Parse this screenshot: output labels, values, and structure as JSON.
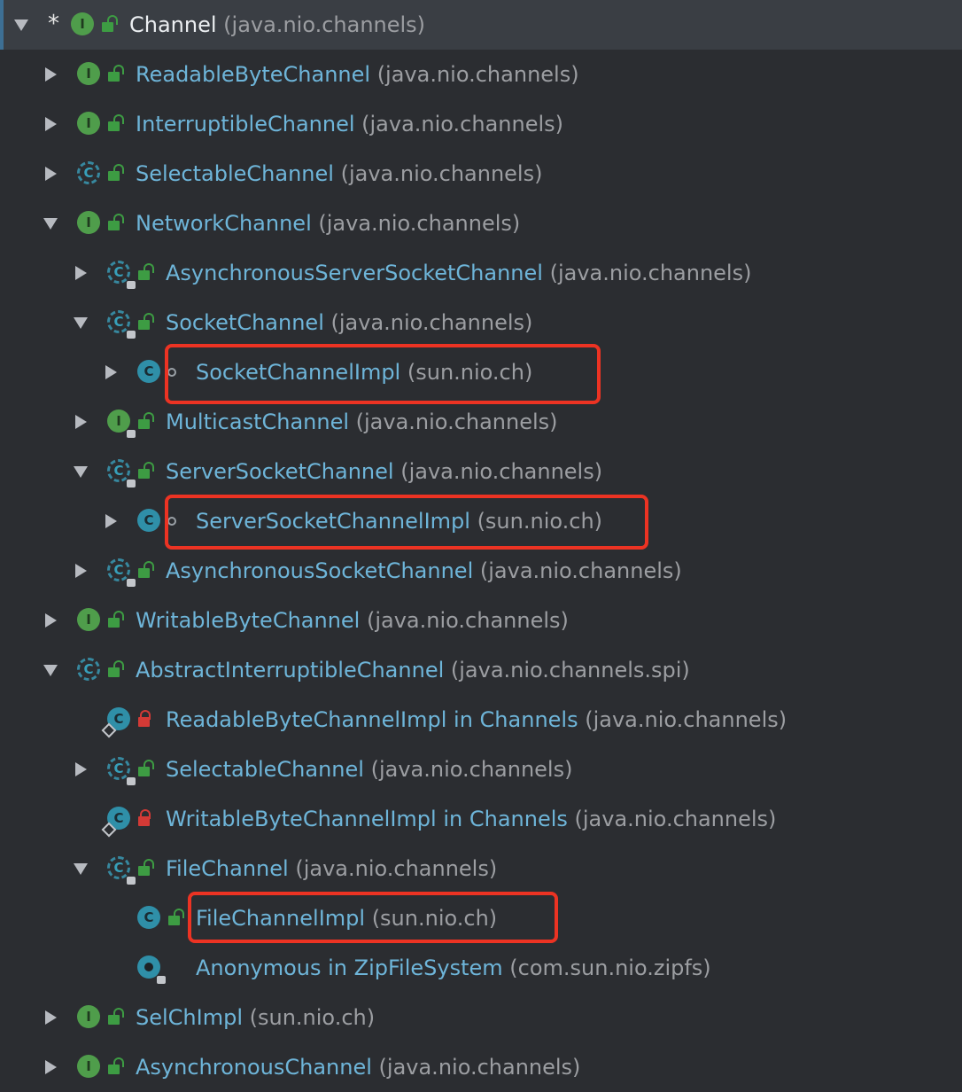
{
  "tree": {
    "rows": [
      {
        "name": "Channel",
        "package": "(java.nio.channels)",
        "root": true,
        "selected": true
      },
      {
        "name": "ReadableByteChannel",
        "package": "(java.nio.channels)"
      },
      {
        "name": "InterruptibleChannel",
        "package": "(java.nio.channels)"
      },
      {
        "name": "SelectableChannel",
        "package": "(java.nio.channels)"
      },
      {
        "name": "NetworkChannel",
        "package": "(java.nio.channels)"
      },
      {
        "name": "AsynchronousServerSocketChannel",
        "package": "(java.nio.channels)"
      },
      {
        "name": "SocketChannel",
        "package": "(java.nio.channels)"
      },
      {
        "name": "SocketChannelImpl",
        "package": "(sun.nio.ch)"
      },
      {
        "name": "MulticastChannel",
        "package": "(java.nio.channels)"
      },
      {
        "name": "ServerSocketChannel",
        "package": "(java.nio.channels)"
      },
      {
        "name": "ServerSocketChannelImpl",
        "package": "(sun.nio.ch)"
      },
      {
        "name": "AsynchronousSocketChannel",
        "package": "(java.nio.channels)"
      },
      {
        "name": "WritableByteChannel",
        "package": "(java.nio.channels)"
      },
      {
        "name": "AbstractInterruptibleChannel",
        "package": "(java.nio.channels.spi)"
      },
      {
        "name": "ReadableByteChannelImpl in Channels",
        "package": "(java.nio.channels)"
      },
      {
        "name": "SelectableChannel",
        "package": "(java.nio.channels)"
      },
      {
        "name": "WritableByteChannelImpl in Channels",
        "package": "(java.nio.channels)"
      },
      {
        "name": "FileChannel",
        "package": "(java.nio.channels)"
      },
      {
        "name": "FileChannelImpl",
        "package": "(sun.nio.ch)"
      },
      {
        "name": "Anonymous in ZipFileSystem",
        "package": "(com.sun.nio.zipfs)"
      },
      {
        "name": "SelChImpl",
        "package": "(sun.nio.ch)"
      },
      {
        "name": "AsynchronousChannel",
        "package": "(java.nio.channels)"
      }
    ],
    "root_marker": "*",
    "type_letters": {
      "interface": "I",
      "class": "C"
    }
  },
  "colors": {
    "background": "#2b2d31",
    "class_name": "#6eb5d9",
    "package": "#9c9ea2",
    "highlight_box": "#ec3323",
    "public_lock": "#3d9c43",
    "private_lock": "#d33a36"
  }
}
